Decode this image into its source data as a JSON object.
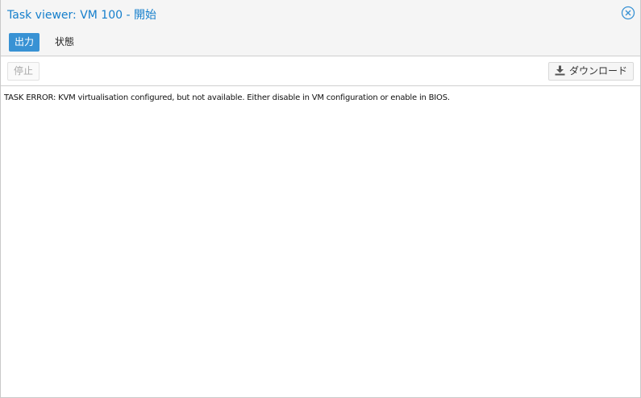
{
  "window": {
    "title": "Task viewer: VM 100 - 開始"
  },
  "tabs": [
    {
      "label": "出力",
      "active": true
    },
    {
      "label": "状態",
      "active": false
    }
  ],
  "toolbar": {
    "stop_label": "停止",
    "download_label": "ダウンロード"
  },
  "icons": {
    "close": "close-circle-icon",
    "download": "download-icon"
  },
  "colors": {
    "accent": "#157fcc",
    "active_tab": "#3892d4"
  },
  "log": {
    "lines": [
      "TASK ERROR: KVM virtualisation configured, but not available. Either disable in VM configuration or enable in BIOS."
    ]
  }
}
